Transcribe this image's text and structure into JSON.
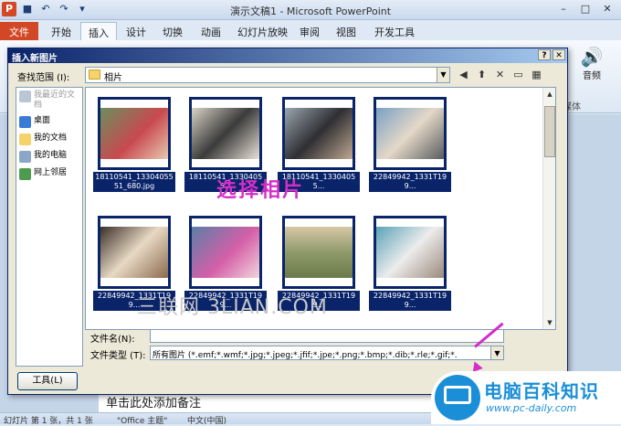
{
  "app": {
    "window_title": "演示文稿1 - Microsoft PowerPoint",
    "tabs": [
      "文件",
      "开始",
      "插入",
      "设计",
      "切换",
      "动画",
      "幻灯片放映",
      "审阅",
      "视图",
      "开发工具"
    ],
    "active_tab": "插入",
    "ribbon_audio_label": "音频",
    "ribbon_group_label": "媒体",
    "notes_placeholder": "单击此处添加备注",
    "status": {
      "slide": "幻灯片 第 1 张，共 1 张",
      "theme": "\"Office 主题\"",
      "language": "中文(中国)"
    }
  },
  "dialog": {
    "title": "插入新图片",
    "lookin_label": "查找范围 (I):",
    "lookin_value": "相片",
    "places": [
      {
        "label": "我最近的文档",
        "disabled": true
      },
      {
        "label": "桌面",
        "disabled": false
      },
      {
        "label": "我的文档",
        "disabled": false
      },
      {
        "label": "我的电脑",
        "disabled": false
      },
      {
        "label": "网上邻居",
        "disabled": false
      }
    ],
    "files": [
      {
        "name": "18110541_1330405551_680.jpg"
      },
      {
        "name": "18110541_13304055..."
      },
      {
        "name": "18110541_13304055..."
      },
      {
        "name": "22849942_1331T199..."
      },
      {
        "name": "22849942_1331T199..."
      },
      {
        "name": "22849942_1331T199..."
      },
      {
        "name": "22849942_1331T199..."
      },
      {
        "name": "22849942_1331T199..."
      }
    ],
    "annotation": "选择相片",
    "watermark": "三联网 3LIAN.COM",
    "filename_label": "文件名(N):",
    "filename_value": "",
    "filetype_label": "文件类型 (T):",
    "filetype_value": "所有图片 (*.emf;*.wmf;*.jpg;*.jpeg;*.jfif;*.jpe;*.png;*.bmp;*.dib;*.rle;*.gif;*.",
    "tools_label": "工具(L)",
    "cancel_label": "取消"
  },
  "brand": {
    "name": "电脑百科知识",
    "url": "www.pc-daily.com"
  },
  "colors": {
    "accent": "#0a246a",
    "annotation": "#d42ec8",
    "brand": "#1a8fd8",
    "file_tab": "#d24726"
  }
}
